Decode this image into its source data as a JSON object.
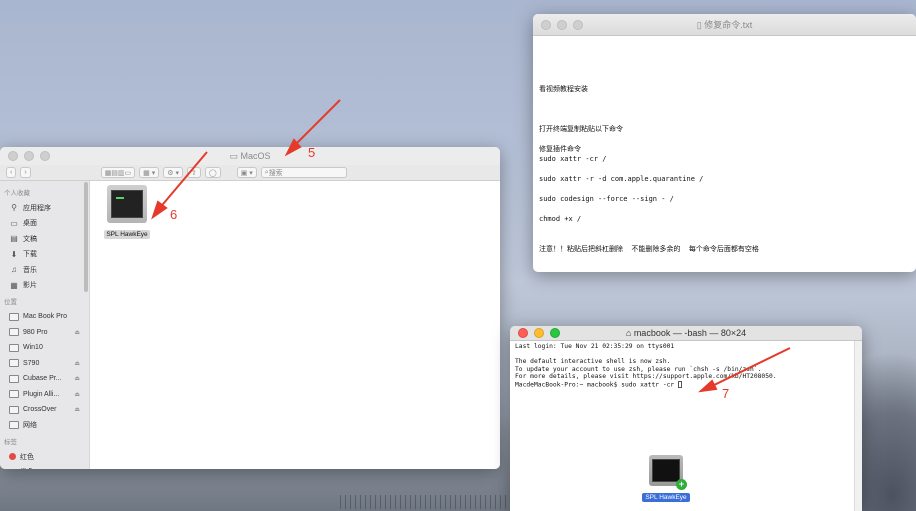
{
  "desktop": {
    "wallpaper": "macOS Big Sur"
  },
  "editor": {
    "title": "修复命令.txt",
    "lines": [
      "",
      "",
      "",
      "",
      "看视频教程安装",
      "",
      "",
      "",
      "打开终端复制粘贴以下命令",
      "",
      "修复插件命令",
      "sudo xattr -cr /",
      "",
      "sudo xattr -r -d com.apple.quarantine /",
      "",
      "sudo codesign --force --sign - /",
      "",
      "chmod +x /",
      "",
      "",
      "注意！！粘贴后把斜杠删除  不能删除多余的  每个命令后面都有空格"
    ]
  },
  "finder": {
    "title": "MacOS",
    "search_placeholder": "搜索",
    "sidebar": {
      "favorites_header": "个人收藏",
      "favorites": [
        {
          "label": "应用程序",
          "icon": "apps-icon"
        },
        {
          "label": "桌面",
          "icon": "desktop-icon"
        },
        {
          "label": "文稿",
          "icon": "documents-icon"
        },
        {
          "label": "下载",
          "icon": "downloads-icon"
        },
        {
          "label": "音乐",
          "icon": "music-icon"
        },
        {
          "label": "影片",
          "icon": "movies-icon"
        }
      ],
      "locations_header": "位置",
      "locations": [
        {
          "label": "Mac Book Pro",
          "eject": false
        },
        {
          "label": "980 Pro",
          "eject": true
        },
        {
          "label": "Win10",
          "eject": false
        },
        {
          "label": "S790",
          "eject": true
        },
        {
          "label": "Cubase Pr...",
          "eject": true
        },
        {
          "label": "Plugin Alli...",
          "eject": true
        },
        {
          "label": "CrossOver",
          "eject": true
        },
        {
          "label": "网络",
          "eject": false
        }
      ],
      "tags_header": "标签",
      "tags": [
        {
          "label": "红色",
          "color": "#e24b45"
        },
        {
          "label": "橙色",
          "color": "#f39a2f"
        }
      ]
    },
    "file": {
      "name": "SPL HawkEye"
    }
  },
  "terminal": {
    "title": "macbook — -bash — 80×24",
    "lines": [
      "Last login: Tue Nov 21 02:35:29 on ttys001",
      "",
      "The default interactive shell is now zsh.",
      "To update your account to use zsh, please run `chsh -s /bin/zsh`.",
      "For more details, please visit https://support.apple.com/kb/HT208050.",
      "MacdeMacBook-Pro:~ macbook$ sudo xattr -cr "
    ]
  },
  "drag": {
    "label": "SPL HawkEye"
  },
  "annotations": [
    {
      "label": "5"
    },
    {
      "label": "6"
    },
    {
      "label": "7"
    }
  ],
  "colors": {
    "annotation": "#e53a2a",
    "selection": "#3a6fd8"
  }
}
